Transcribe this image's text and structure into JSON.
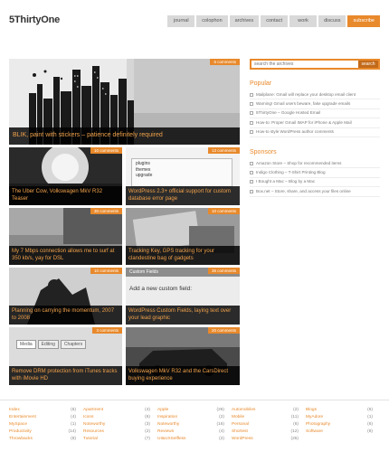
{
  "site": {
    "logo": "5ThirtyOne"
  },
  "nav": [
    {
      "label": "journal",
      "active": false
    },
    {
      "label": "colophon",
      "active": false
    },
    {
      "label": "archives",
      "active": false
    },
    {
      "label": "contact",
      "active": false
    },
    {
      "label": "work",
      "active": false
    },
    {
      "label": "discuss",
      "active": false
    },
    {
      "label": "subscribe",
      "active": true
    }
  ],
  "hero": {
    "badge": "6 comments",
    "caption": "BLIK, paint with stickers – patience definitely required"
  },
  "posts": [
    {
      "badge": "10 comments",
      "caption": "The Uber Cow, Volkswagen MkV R32 Teaser"
    },
    {
      "badge": "13 comments",
      "caption": "WordPress 2.3+ official support for custom database error page"
    },
    {
      "badge": "30 comments",
      "caption": "My 7 Mbps connection allows me to surf at 350 kb/s, yay for DSL"
    },
    {
      "badge": "10 comments",
      "caption": "Tracking Key, GPS tracking for your clandestine bag of gadgets"
    },
    {
      "badge": "10 comments",
      "caption": "Planning on carrying the momentum, 2007 to 2008"
    },
    {
      "badge": "36 comments",
      "caption": "WordPress Custom Fields, laying text over your lead graphic"
    },
    {
      "badge": "3 comments",
      "caption": "Remove DRM protection from iTunes tracks with iMovie HD"
    },
    {
      "badge": "20 comments",
      "caption": "Volkswagen MkV R32 and the CarsDirect buying experience"
    }
  ],
  "tile_text": {
    "finder_items": [
      "plugins",
      "themes",
      "upgrade"
    ],
    "custom_fields_header": "Custom Fields",
    "custom_fields_prompt": "Add a new custom field:",
    "imovie_tabs": [
      "Media",
      "Editing",
      "Chapters"
    ]
  },
  "sidebar": {
    "search_placeholder": "search the archives",
    "search_button": "search",
    "popular_heading": "Popular",
    "popular": [
      "Mailplane: Gmail will replace your desktop email client",
      "Warning! Gmail users beware, fake upgrade emails",
      "5ThirtyOne – Google Hosted Email",
      "How-to: Proper Gmail IMAP for iPhone & Apple Mail",
      "How-to style WordPress author comments"
    ],
    "sponsors_heading": "Sponsors",
    "sponsors": [
      "Amazon Store – Shop for recommended items",
      "Indigo Clothing – T-Shirt Printing Blog",
      "I Bought a Mac – Blog by a Mac",
      "Box.net – Store, share, and access your files online"
    ]
  },
  "tags": [
    {
      "name": "Index",
      "count": "(6)"
    },
    {
      "name": "Apartment",
      "count": "(4)"
    },
    {
      "name": "Apple",
      "count": "(26)"
    },
    {
      "name": "Automobiles",
      "count": "(2)"
    },
    {
      "name": "Blogs",
      "count": "(6)"
    },
    {
      "name": "Entertainment",
      "count": "(4)"
    },
    {
      "name": "Icons",
      "count": "(6)"
    },
    {
      "name": "Inspiration",
      "count": "(2)"
    },
    {
      "name": "Mobile",
      "count": "(11)"
    },
    {
      "name": "MyAdore",
      "count": "(1)"
    },
    {
      "name": "MySpace",
      "count": "(1)"
    },
    {
      "name": "Noteworthy",
      "count": "(3)"
    },
    {
      "name": "Noteworthy",
      "count": "(16)"
    },
    {
      "name": "Personal",
      "count": "(6)"
    },
    {
      "name": "Photography",
      "count": "(6)"
    },
    {
      "name": "Productivity",
      "count": "(14)"
    },
    {
      "name": "Resources",
      "count": "(2)"
    },
    {
      "name": "Reviews",
      "count": "(4)"
    },
    {
      "name": "Shortest",
      "count": "(12)"
    },
    {
      "name": "Software",
      "count": "(8)"
    },
    {
      "name": "Throwbacks",
      "count": "(8)"
    },
    {
      "name": "Tutorial",
      "count": "(7)"
    },
    {
      "name": "UI&UXSelfless",
      "count": "(2)"
    },
    {
      "name": "WordPress",
      "count": "(25)"
    }
  ]
}
